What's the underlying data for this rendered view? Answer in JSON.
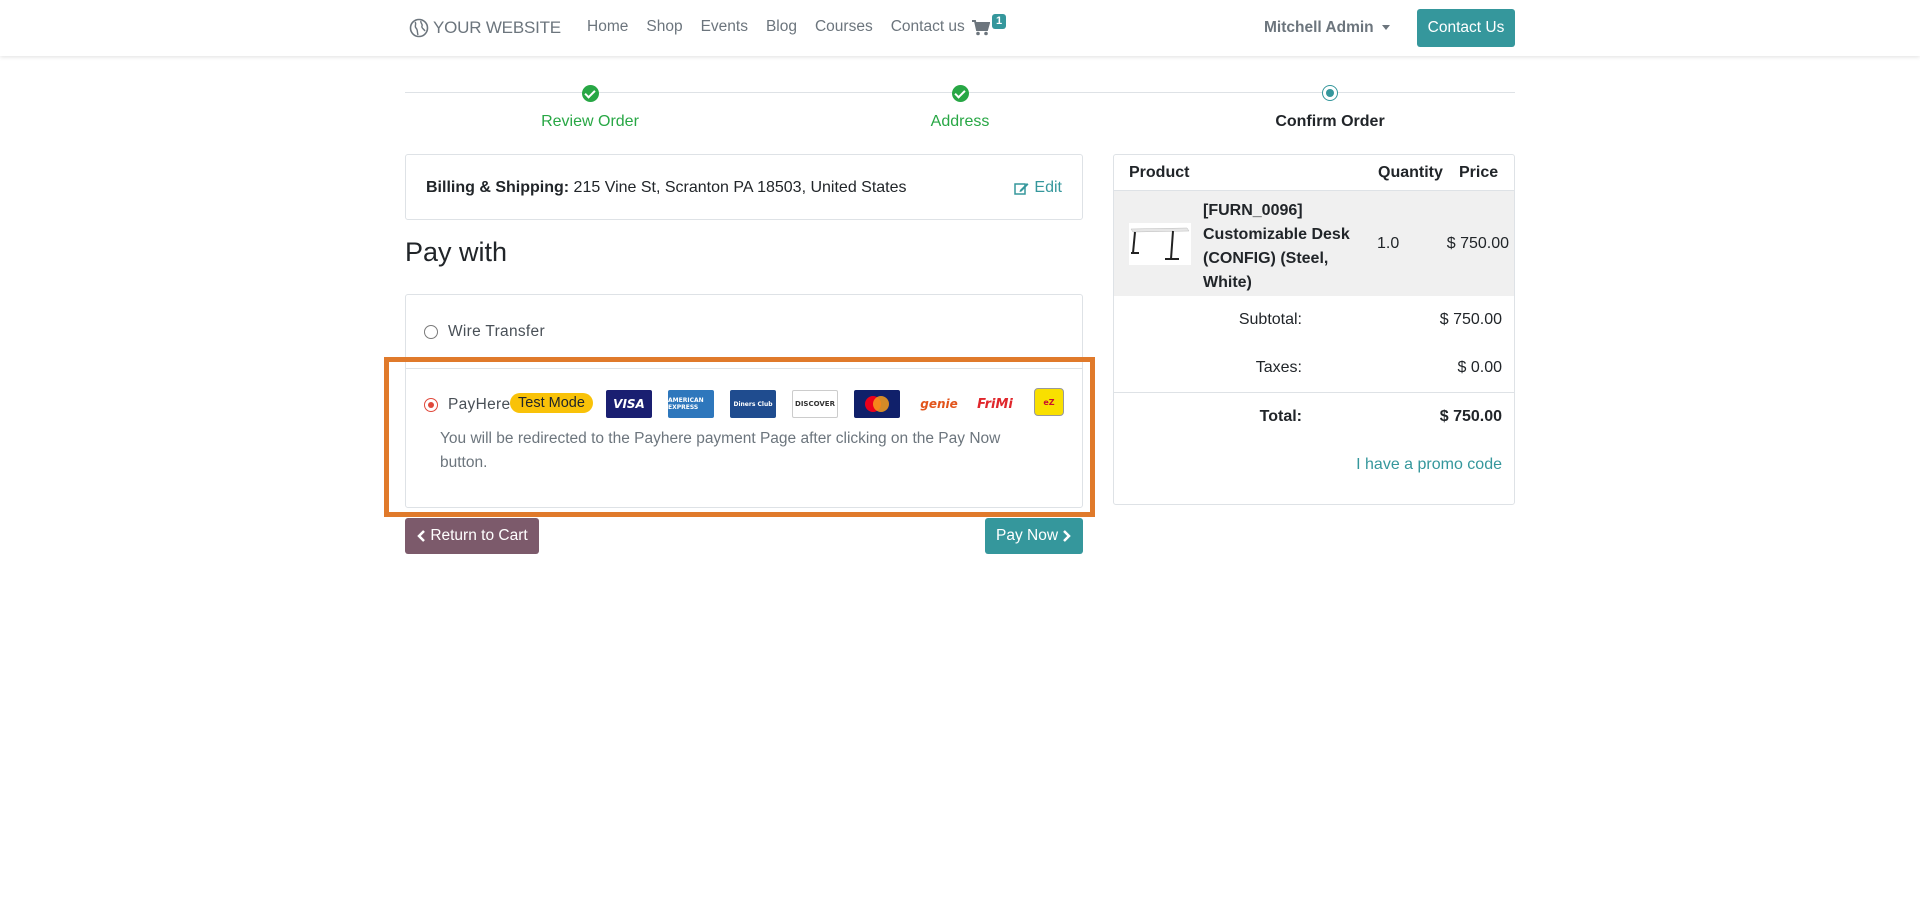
{
  "nav": {
    "brand": "YOUR WEBSITE",
    "links": [
      "Home",
      "Shop",
      "Events",
      "Blog",
      "Courses",
      "Contact us"
    ],
    "cart_count": "1",
    "user": "Mitchell Admin",
    "contact_button": "Contact Us"
  },
  "steps": [
    {
      "label": "Review Order",
      "state": "done"
    },
    {
      "label": "Address",
      "state": "done"
    },
    {
      "label": "Confirm Order",
      "state": "current"
    }
  ],
  "billing": {
    "label": "Billing & Shipping:",
    "address": "215 Vine St, Scranton PA 18503, United States",
    "edit": "Edit"
  },
  "pay_with_title": "Pay with",
  "payment_methods": [
    {
      "label": "Wire Transfer",
      "selected": false
    },
    {
      "label": "PayHere",
      "selected": true,
      "badge": "Test Mode",
      "icons": [
        "visa-icon",
        "amex-icon",
        "diners-club-icon",
        "discover-icon",
        "mastercard-icon",
        "genie-icon",
        "frimi-icon",
        "ezcash-icon"
      ],
      "description": "You will be redirected to the Payhere payment Page after clicking on the Pay Now button."
    }
  ],
  "buttons": {
    "return": "Return to Cart",
    "pay_now": "Pay Now"
  },
  "summary": {
    "headers": {
      "product": "Product",
      "quantity": "Quantity",
      "price": "Price"
    },
    "item": {
      "name": "[FURN_0096] Customizable Desk (CONFIG) (Steel, White)",
      "quantity": "1.0",
      "price": "$ 750.00"
    },
    "subtotal_label": "Subtotal:",
    "subtotal": "$ 750.00",
    "taxes_label": "Taxes:",
    "taxes": "$ 0.00",
    "total_label": "Total:",
    "total": "$ 750.00",
    "promo": "I have a promo code"
  },
  "colors": {
    "primary": "#35979c",
    "success": "#28a745",
    "secondary": "#7c5a6b",
    "highlight": "#e07a2b",
    "badge": "#f9c208"
  }
}
